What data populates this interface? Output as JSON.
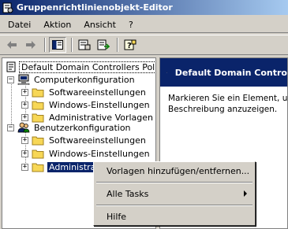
{
  "window": {
    "title": "Gruppenrichtlinienobjekt-Editor"
  },
  "menubar": {
    "items": [
      {
        "label": "Datei"
      },
      {
        "label": "Aktion"
      },
      {
        "label": "Ansicht"
      },
      {
        "label": "?"
      }
    ]
  },
  "toolbar": {
    "buttons": [
      "back-arrow-icon",
      "forward-arrow-icon",
      "show-hide-tree-icon",
      "properties-icon",
      "export-list-icon",
      "help-icon"
    ]
  },
  "tree": {
    "root": "Default Domain Controllers Policy [s",
    "computer_config": "Computerkonfiguration",
    "cc_children": [
      "Softwareeinstellungen",
      "Windows-Einstellungen",
      "Administrative Vorlagen"
    ],
    "user_config": "Benutzerkonfiguration",
    "uc_children": [
      "Softwareeinstellungen",
      "Windows-Einstellungen",
      "Administrative Vorlagen"
    ]
  },
  "right_pane": {
    "header": "Default Domain Contro",
    "description_line1": "Markieren Sie ein Element, um de",
    "description_line2": "Beschreibung anzuzeigen."
  },
  "context_menu": {
    "items": [
      {
        "label": "Vorlagen hinzufügen/entfernen..."
      },
      {
        "label": "Alle Tasks"
      },
      {
        "label": "Hilfe"
      }
    ]
  },
  "colors": {
    "selection": "#0a246a",
    "face": "#d4d0c8",
    "folder": "#f7d756"
  }
}
